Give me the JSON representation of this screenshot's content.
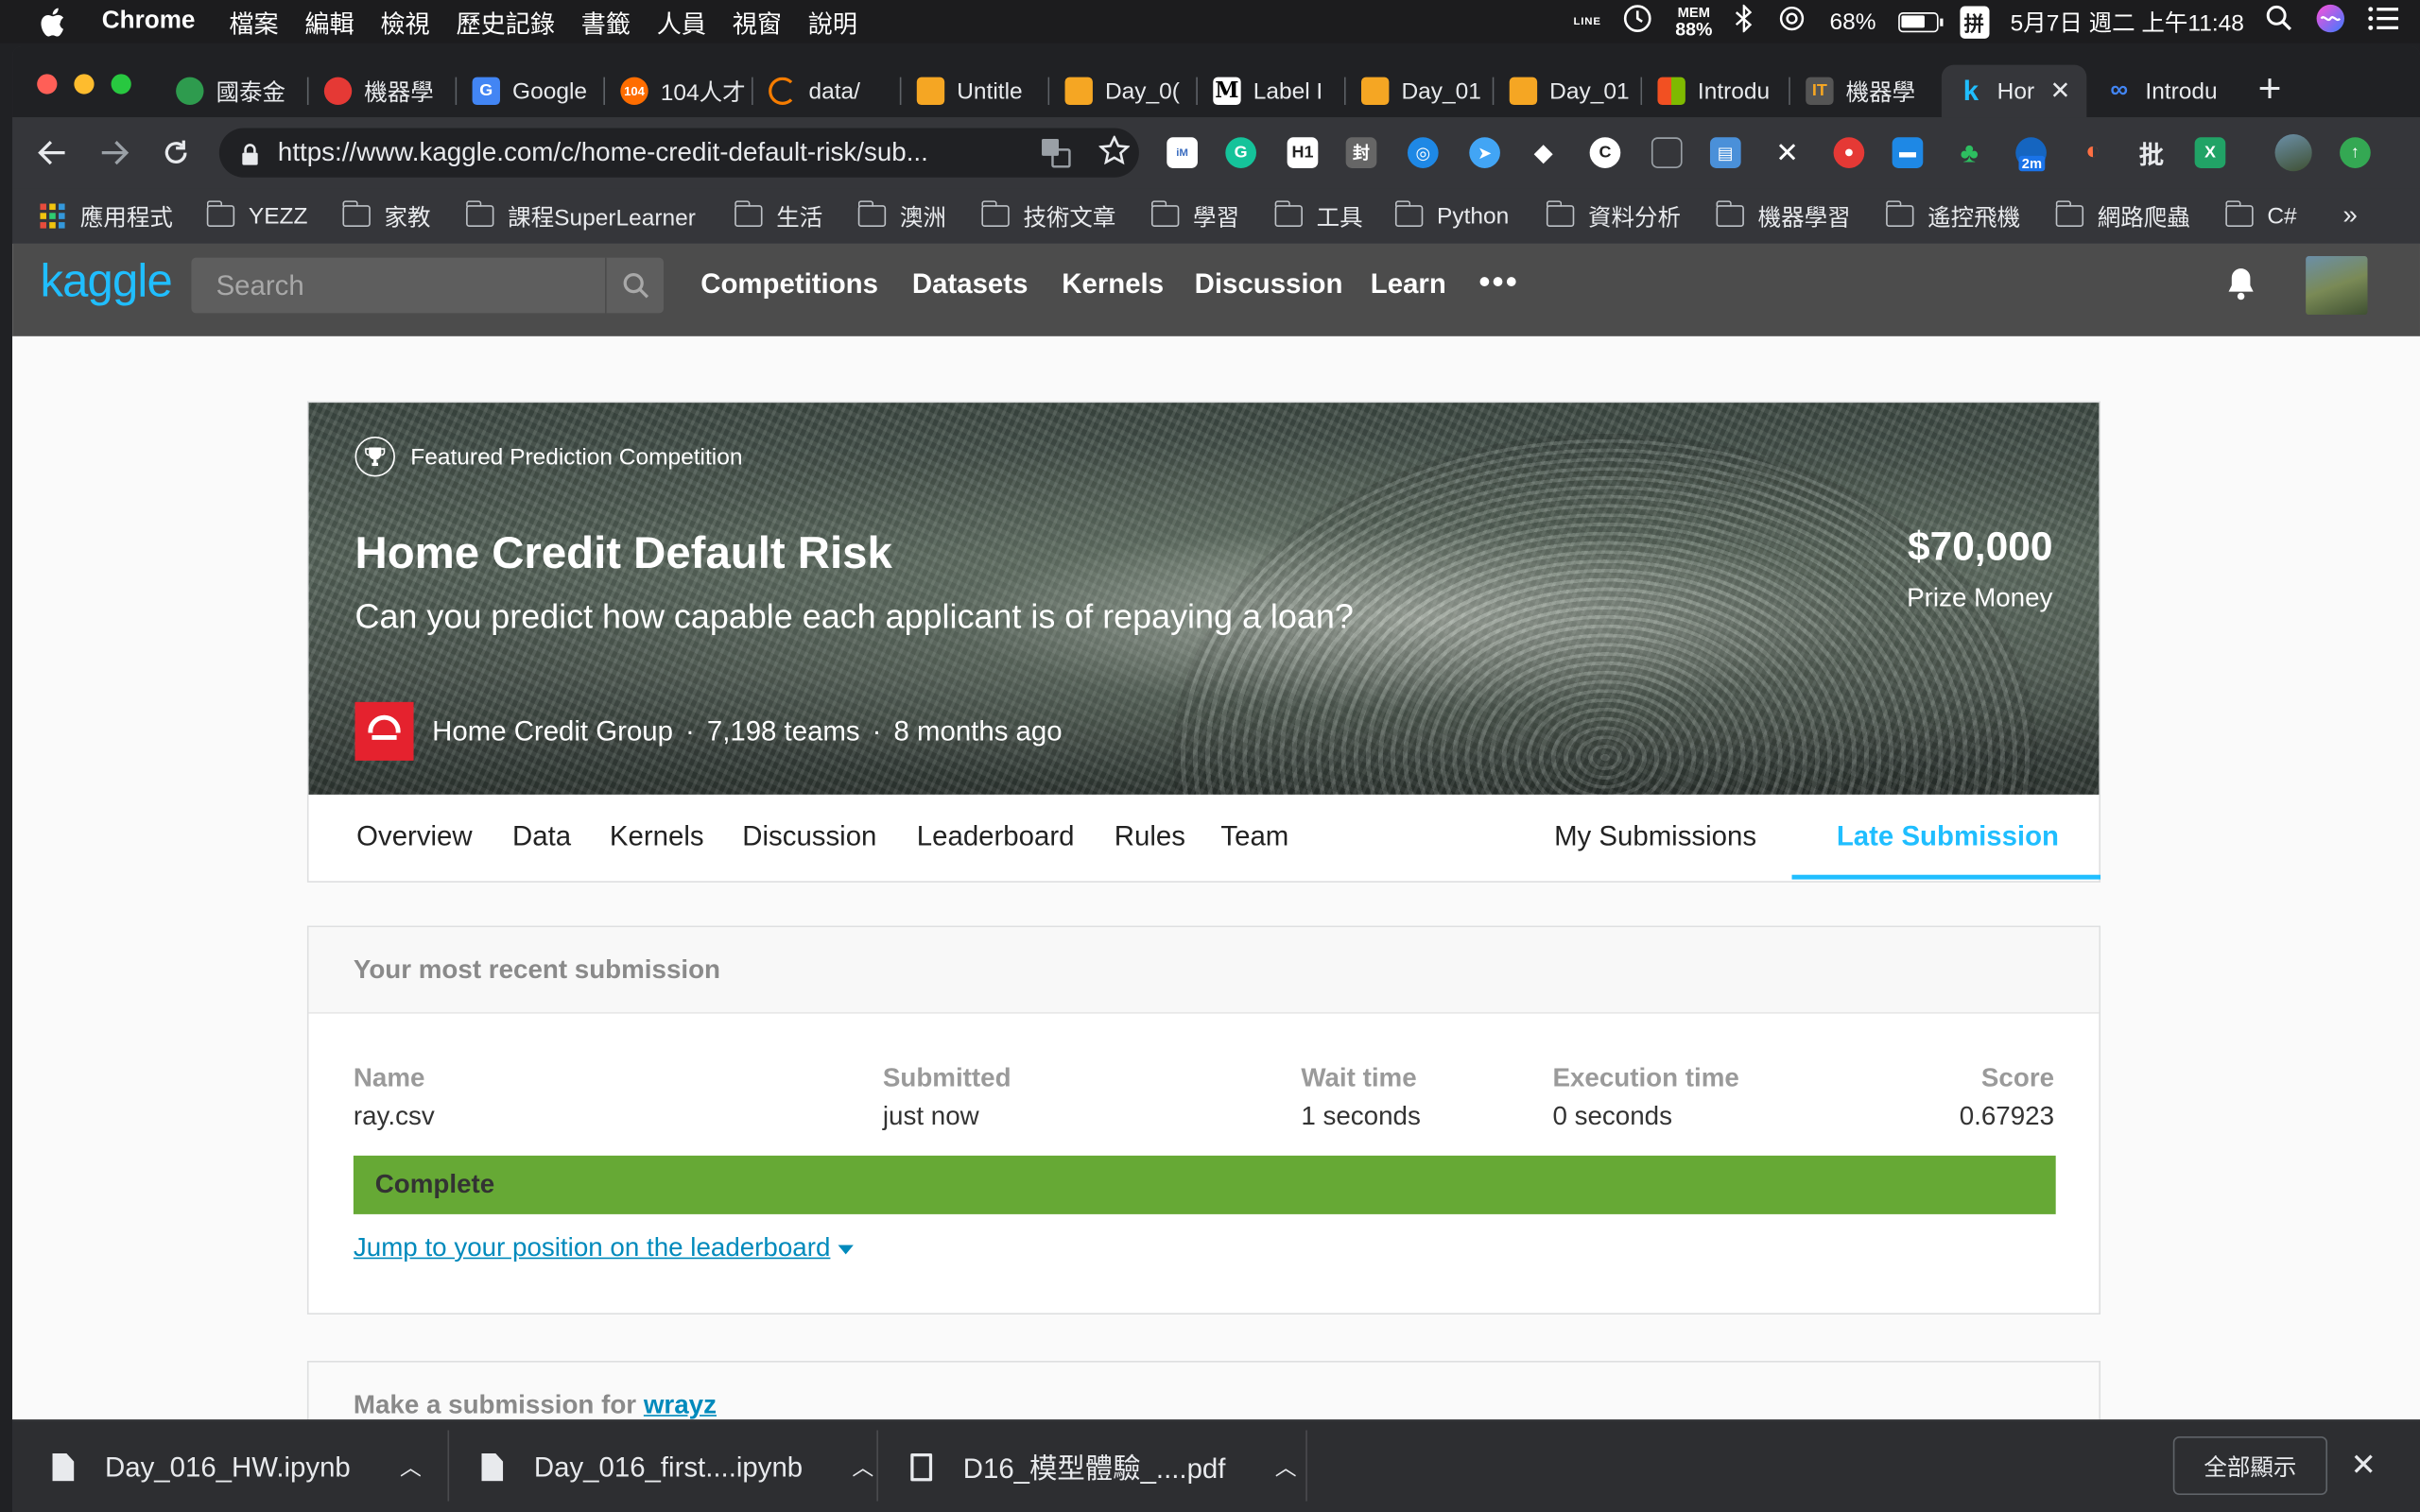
{
  "menubar": {
    "app": "Chrome",
    "items": [
      "檔案",
      "編輯",
      "檢視",
      "歷史記錄",
      "書籤",
      "人員",
      "視窗",
      "說明"
    ],
    "status": {
      "line": "LINE",
      "mem_label": "MEM",
      "mem_value": "88%",
      "battery": "68%",
      "input_method": "拼",
      "datetime": "5月7日 週二 上午11:48"
    }
  },
  "tabs": [
    {
      "label": "國泰金",
      "color": "#2e9b4e"
    },
    {
      "label": "機器學",
      "color": "#e53935"
    },
    {
      "label": "Google",
      "color": "#4285f4"
    },
    {
      "label": "104人才",
      "color": "#ff6d00"
    },
    {
      "label": "data/",
      "color": "#f57c00"
    },
    {
      "label": "Untitle",
      "color": "#f5a623"
    },
    {
      "label": "Day_0(",
      "color": "#f5a623"
    },
    {
      "label": "Label I",
      "color": "#000000"
    },
    {
      "label": "Day_01",
      "color": "#f5a623"
    },
    {
      "label": "Day_01",
      "color": "#f5a623"
    },
    {
      "label": "Introdu",
      "color": "#7fba00"
    },
    {
      "label": "機器學",
      "color": "#555555"
    },
    {
      "label": "Hor",
      "color": "#20beff",
      "active": true
    },
    {
      "label": "Introdu",
      "color": "#4285f4"
    }
  ],
  "omnibox": {
    "url": "https://www.kaggle.com/c/home-credit-default-risk/sub..."
  },
  "extensions": {
    "badge": "2m",
    "icons": [
      "imacros",
      "grammarly",
      "h1",
      "fengyun",
      "compass",
      "rocket",
      "diamond",
      "ghost",
      "evernote-like",
      "screenshot",
      "scissors",
      "shield",
      "ruler",
      "evernote",
      "badge",
      "headphone",
      "pi",
      "excel",
      "avatar",
      "update"
    ]
  },
  "bookmarks": [
    {
      "label": "應用程式",
      "type": "apps"
    },
    {
      "label": "YEZZ",
      "type": "folder"
    },
    {
      "label": "家教",
      "type": "folder"
    },
    {
      "label": "課程SuperLearner",
      "type": "folder"
    },
    {
      "label": "生活",
      "type": "folder"
    },
    {
      "label": "澳洲",
      "type": "folder"
    },
    {
      "label": "技術文章",
      "type": "folder"
    },
    {
      "label": "學習",
      "type": "folder"
    },
    {
      "label": "工具",
      "type": "folder"
    },
    {
      "label": "Python",
      "type": "folder"
    },
    {
      "label": "資料分析",
      "type": "folder"
    },
    {
      "label": "機器學習",
      "type": "folder"
    },
    {
      "label": "遙控飛機",
      "type": "folder"
    },
    {
      "label": "網路爬蟲",
      "type": "folder"
    },
    {
      "label": "C#",
      "type": "folder"
    }
  ],
  "bookmarks_more": "»",
  "kaggle": {
    "logo": "kaggle",
    "search_placeholder": "Search",
    "nav": [
      "Competitions",
      "Datasets",
      "Kernels",
      "Discussion",
      "Learn"
    ],
    "more": "•••"
  },
  "competition": {
    "featured": "Featured Prediction Competition",
    "title": "Home Credit Default Risk",
    "subtitle": "Can you predict how capable each applicant is of repaying a loan?",
    "host": "Home Credit Group",
    "teams": "7,198 teams",
    "time": "8 months ago",
    "prize_amount": "$70,000",
    "prize_label": "Prize Money",
    "tabs": [
      "Overview",
      "Data",
      "Kernels",
      "Discussion",
      "Leaderboard",
      "Rules",
      "Team"
    ],
    "right_tabs": [
      "My Submissions",
      "Late Submission"
    ]
  },
  "submission": {
    "header": "Your most recent submission",
    "columns": {
      "name": {
        "label": "Name",
        "value": "ray.csv"
      },
      "submitted": {
        "label": "Submitted",
        "value": "just now"
      },
      "wait": {
        "label": "Wait time",
        "value": "1 seconds"
      },
      "execution": {
        "label": "Execution time",
        "value": "0 seconds"
      },
      "score": {
        "label": "Score",
        "value": "0.67923"
      }
    },
    "status": "Complete",
    "status_color": "#66a935",
    "jump_link": "Jump to your position on the leaderboard"
  },
  "make_submission": {
    "prefix": "Make a submission for",
    "user": "wrayz"
  },
  "downloads": [
    {
      "name": "Day_016_HW.ipynb",
      "type": "file"
    },
    {
      "name": "Day_016_first....ipynb",
      "type": "file"
    },
    {
      "name": "D16_模型體驗_....pdf",
      "type": "pdf"
    }
  ],
  "downloads_show_all": "全部顯示",
  "colors": {
    "kaggle_blue": "#20beff",
    "link_blue": "#008abc",
    "host_red": "#e5222e"
  }
}
